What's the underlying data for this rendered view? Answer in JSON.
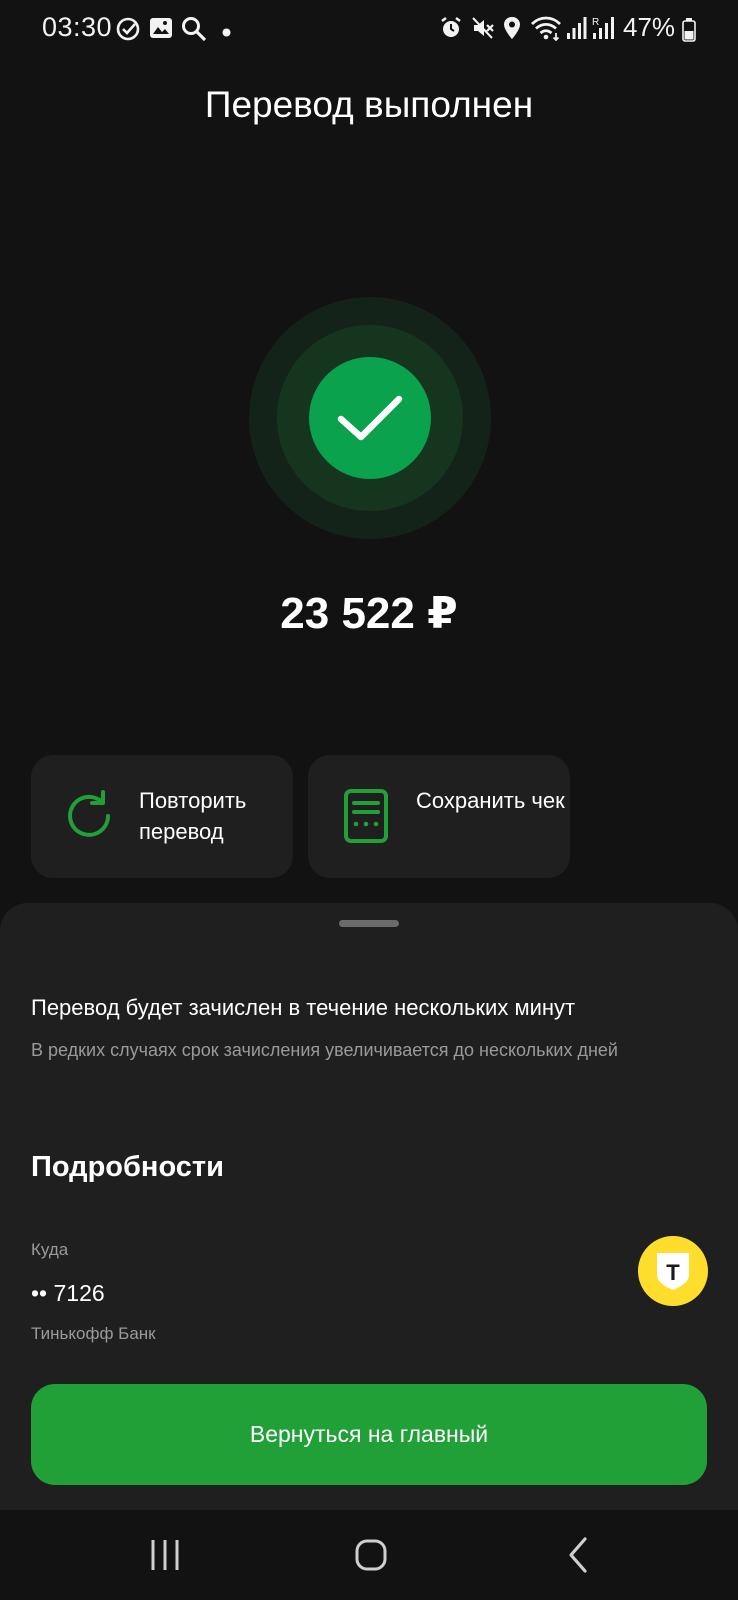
{
  "status_bar": {
    "time": "03:30",
    "battery": "47%",
    "icons": [
      "check-circle-icon",
      "image-icon",
      "search-icon",
      "dot-icon",
      "alarm-icon",
      "mute-icon",
      "location-icon",
      "wifi-icon",
      "signal-icon",
      "signal-r-icon",
      "battery-icon"
    ]
  },
  "header": {
    "title": "Перевод выполнен"
  },
  "status": {
    "icon": "check-icon",
    "color": "#0aa24d"
  },
  "amount": "23 522 ₽",
  "actions": [
    {
      "label": "Повторить перевод",
      "icon": "repeat-icon"
    },
    {
      "label": "Сохранить чек",
      "icon": "receipt-icon"
    }
  ],
  "sheet": {
    "notice_title": "Перевод будет зачислен в течение нескольких минут",
    "notice_subtitle": "В редких случаях срок зачисления увеличивается до нескольких дней",
    "details_heading": "Подробности",
    "recipient": {
      "label": "Куда",
      "card": "•• 7126",
      "bank": "Тинькофф Банк",
      "bank_logo_letter": "Т",
      "bank_logo_color": "#ffdd2d"
    }
  },
  "home_button": {
    "label": "Вернуться на главный",
    "color": "#21a038"
  },
  "nav_bar": {
    "buttons": [
      "recent-apps-icon",
      "home-icon",
      "back-icon"
    ]
  }
}
